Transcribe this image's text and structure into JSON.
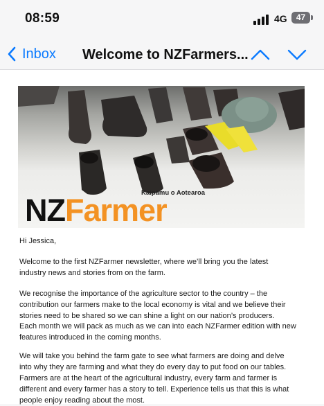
{
  "status_bar": {
    "time": "08:59",
    "network": "4G",
    "battery": "47"
  },
  "nav": {
    "back_label": "Inbox",
    "title": "Welcome to NZFarmers..."
  },
  "email": {
    "banner": {
      "tagline": "Kaipāmu o Aotearoa",
      "logo_part1": "NZ",
      "logo_part2": "Farmer"
    },
    "greeting": "Hi Jessica,",
    "paragraphs": [
      "Welcome to the first NZFarmer newsletter, where we’ll bring you the latest industry news and stories from on the farm.",
      "We recognise the importance of the agriculture sector to the country – the contribution our farmers make to the local economy is vital and we believe their stories need to be shared so we can shine a light on our nation’s producers.",
      "Each month we will pack as much as we can into each NZFarmer edition with new features introduced in the coming months.",
      "We will take you behind the farm gate to see what farmers are doing and delve into why they are farming and what they do every day to put food on our tables. Farmers are at the heart of the agricultural industry, every farm and farmer is different and every farmer has a story to tell. Experience tells us that this is what people enjoy reading about the most."
    ]
  },
  "colors": {
    "link_blue": "#0a7aff",
    "brand_orange": "#f39223"
  }
}
